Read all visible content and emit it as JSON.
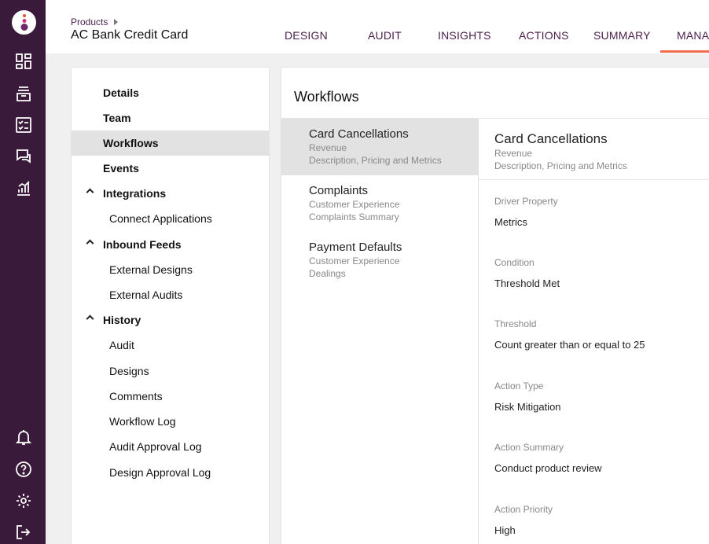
{
  "header": {
    "breadcrumb": "Products",
    "title": "AC Bank Credit Card",
    "tabs": [
      {
        "label": "DESIGN"
      },
      {
        "label": "AUDIT"
      },
      {
        "label": "INSIGHTS"
      },
      {
        "label": "ACTIONS"
      },
      {
        "label": "SUMMARY"
      },
      {
        "label": "MANA"
      }
    ],
    "active_tab_color": "#ef6e4f"
  },
  "rail": {
    "background": "#3a1a3a",
    "icons": [
      "dashboard-icon",
      "archive-icon",
      "checklist-icon",
      "chat-icon",
      "analytics-icon",
      "bell-icon",
      "help-icon",
      "settings-icon",
      "logout-icon"
    ]
  },
  "menu": {
    "items": [
      {
        "label": "Details"
      },
      {
        "label": "Team"
      },
      {
        "label": "Workflows"
      },
      {
        "label": "Events"
      },
      {
        "label": "Integrations"
      },
      {
        "label": "Connect Applications"
      },
      {
        "label": "Inbound Feeds"
      },
      {
        "label": "External Designs"
      },
      {
        "label": "External Audits"
      },
      {
        "label": "History"
      },
      {
        "label": "Audit"
      },
      {
        "label": "Designs"
      },
      {
        "label": "Comments"
      },
      {
        "label": "Workflow Log"
      },
      {
        "label": "Audit Approval Log"
      },
      {
        "label": "Design Approval Log"
      }
    ]
  },
  "workflows": {
    "title": "Workflows",
    "items": [
      {
        "name": "Card Cancellations",
        "category": "Revenue",
        "description": "Description, Pricing and Metrics"
      },
      {
        "name": "Complaints",
        "category": "Customer Experience",
        "description": "Complaints Summary"
      },
      {
        "name": "Payment Defaults",
        "category": "Customer Experience",
        "description": "Dealings"
      }
    ],
    "detail": {
      "name": "Card Cancellations",
      "category": "Revenue",
      "description": "Description, Pricing and Metrics",
      "fields": [
        {
          "label": "Driver Property",
          "value": "Metrics"
        },
        {
          "label": "Condition",
          "value": "Threshold Met"
        },
        {
          "label": "Threshold",
          "value": "Count greater than or equal to 25"
        },
        {
          "label": "Action Type",
          "value": "Risk Mitigation"
        },
        {
          "label": "Action Summary",
          "value": "Conduct product review"
        },
        {
          "label": "Action Priority",
          "value": "High"
        }
      ]
    }
  }
}
